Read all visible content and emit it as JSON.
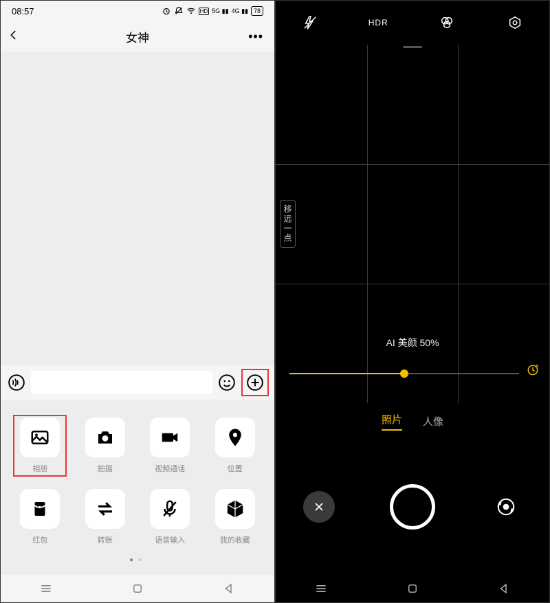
{
  "left": {
    "status": {
      "time": "08:57",
      "battery": "78"
    },
    "header": {
      "title": "女神"
    },
    "panel_items": [
      {
        "key": "album",
        "label": "相册",
        "icon": "image-icon",
        "highlight": true
      },
      {
        "key": "camera",
        "label": "拍摄",
        "icon": "camera-icon",
        "highlight": false
      },
      {
        "key": "video",
        "label": "视频通话",
        "icon": "video-icon",
        "highlight": false
      },
      {
        "key": "location",
        "label": "位置",
        "icon": "pin-icon",
        "highlight": false
      },
      {
        "key": "redpacket",
        "label": "红包",
        "icon": "packet-icon",
        "highlight": false
      },
      {
        "key": "transfer",
        "label": "转账",
        "icon": "transfer-icon",
        "highlight": false
      },
      {
        "key": "voice",
        "label": "语音输入",
        "icon": "mic-icon",
        "highlight": false
      },
      {
        "key": "favorite",
        "label": "我的收藏",
        "icon": "cube-icon",
        "highlight": false
      }
    ]
  },
  "right": {
    "viewfinder_hint": "移远一点",
    "ai_text": "AI 美颜 50%",
    "ai_value": 50,
    "modes": [
      {
        "key": "photo",
        "label": "照片",
        "active": true
      },
      {
        "key": "portrait",
        "label": "人像",
        "active": false
      }
    ],
    "hdr_label": "HDR"
  }
}
